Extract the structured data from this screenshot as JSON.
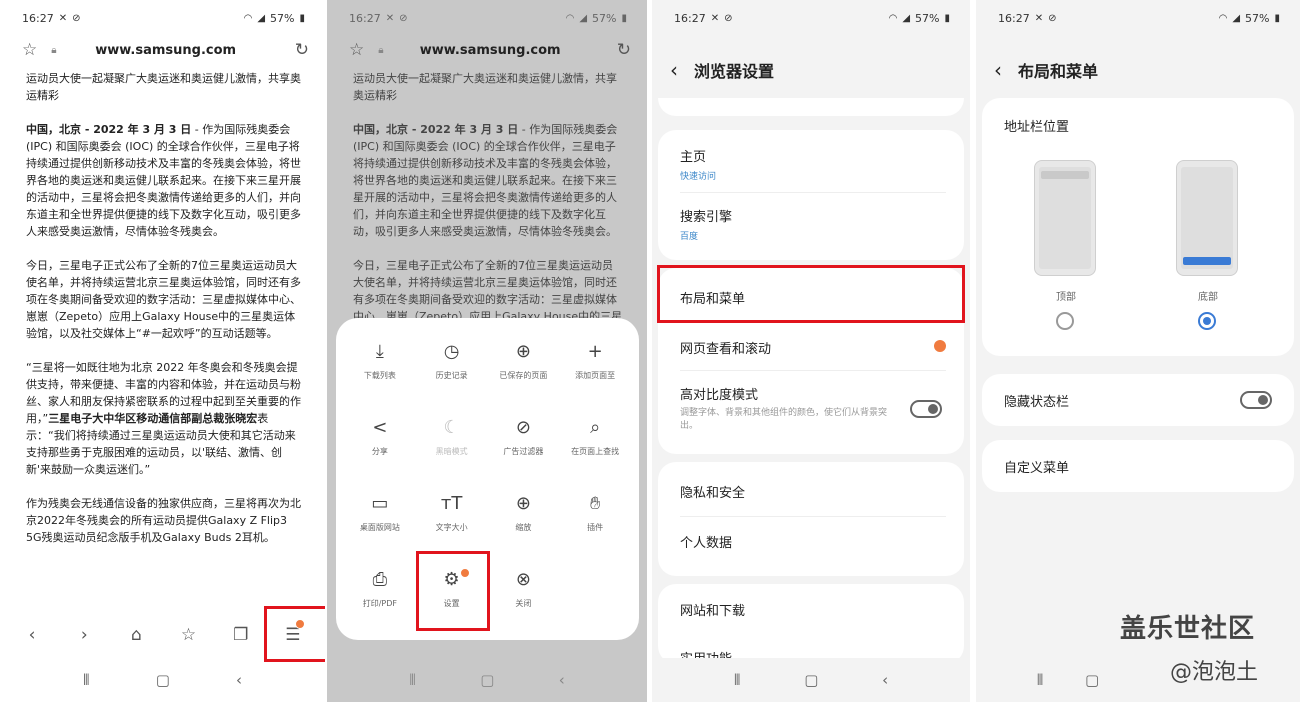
{
  "status": {
    "time": "16:27",
    "battery": "57%"
  },
  "browser": {
    "url": "www.samsung.com",
    "article": {
      "p0": "运动员大使一起凝聚广大奥运迷和奥运健儿激情，共享奥运精彩",
      "p1_bold": "中国，北京 - 2022 年 3 月 3 日",
      "p1": " - 作为国际残奥委会(IPC) 和国际奥委会 (IOC) 的全球合作伙伴，三星电子将持续通过提供创新移动技术及丰富的冬残奥会体验，将世界各地的奥运迷和奥运健儿联系起来。在接下来三星开展的活动中，三星将会把冬奥激情传递给更多的人们，并向东道主和全世界提供便捷的线下及数字化互动，吸引更多人来感受奥运激情，尽情体验冬残奥会。",
      "p2": "今日，三星电子正式公布了全新的7位三星奥运运动员大使名单，并将持续运营北京三星奥运体验馆，同时还有多项在冬奥期间备受欢迎的数字活动：三星虚拟媒体中心、崽崽（Zepeto）应用上Galaxy House中的三星奥运体验馆，以及社交媒体上“#一起欢呼”的互动话题等。",
      "p3a": "“三星将一如既往地为北京 2022 年冬奥会和冬残奥会提供支持，带来便捷、丰富的内容和体验，并在运动员与粉丝、家人和朋友保持紧密联系的过程中起到至关重要的作用，”",
      "p3_bold": "三星电子大中华区移动通信部副总裁张晓宏",
      "p3b": "表示：“我们将持续通过三星奥运运动员大使和其它活动来支持那些勇于克服困难的运动员，以'联结、激情、创新'来鼓励一众奥运迷们。”",
      "p4": "作为残奥会无线通信设备的独家供应商，三星将再次为北京2022年冬残奥会的所有运动员提供Galaxy Z Flip3 5G残奥运动员纪念版手机及Galaxy Buds 2耳机。"
    }
  },
  "menu": {
    "items": [
      {
        "label": "下载列表",
        "icon": "download-icon"
      },
      {
        "label": "历史记录",
        "icon": "history-icon"
      },
      {
        "label": "已保存的页面",
        "icon": "saved-pages-icon"
      },
      {
        "label": "添加页面至",
        "icon": "add-icon"
      },
      {
        "label": "分享",
        "icon": "share-icon"
      },
      {
        "label": "黑暗模式",
        "icon": "moon-icon",
        "disabled": true
      },
      {
        "label": "广告过滤器",
        "icon": "block-icon"
      },
      {
        "label": "在页面上查找",
        "icon": "find-icon"
      },
      {
        "label": "桌面版网站",
        "icon": "desktop-icon"
      },
      {
        "label": "文字大小",
        "icon": "text-size-icon"
      },
      {
        "label": "缩放",
        "icon": "zoom-icon"
      },
      {
        "label": "插件",
        "icon": "plugin-icon"
      },
      {
        "label": "打印/PDF",
        "icon": "print-icon"
      },
      {
        "label": "设置",
        "icon": "settings-icon"
      },
      {
        "label": "关闭",
        "icon": "close-icon"
      }
    ]
  },
  "settings": {
    "title": "浏览器设置",
    "home": {
      "label": "主页",
      "sub": "快速访问"
    },
    "search": {
      "label": "搜索引擎",
      "sub": "百度"
    },
    "layout": "布局和菜单",
    "scroll": "网页查看和滚动",
    "contrast": {
      "label": "高对比度模式",
      "desc": "调整字体、背景和其他组件的颜色，使它们从背景突出。"
    },
    "privacy": "隐私和安全",
    "personal": "个人数据",
    "sites": "网站和下载",
    "more": "实用功能"
  },
  "layout": {
    "title": "布局和菜单",
    "addr_position": "地址栏位置",
    "top": "顶部",
    "bottom": "底部",
    "selected": "bottom",
    "hide_status": "隐藏状态栏",
    "custom_menu": "自定义菜单"
  },
  "watermark": {
    "line1": "盖乐世社区",
    "line2": "@泡泡土"
  },
  "colors": {
    "highlight": "#e1141d",
    "accent": "#3a7bd5",
    "badge": "#f07b3f"
  }
}
